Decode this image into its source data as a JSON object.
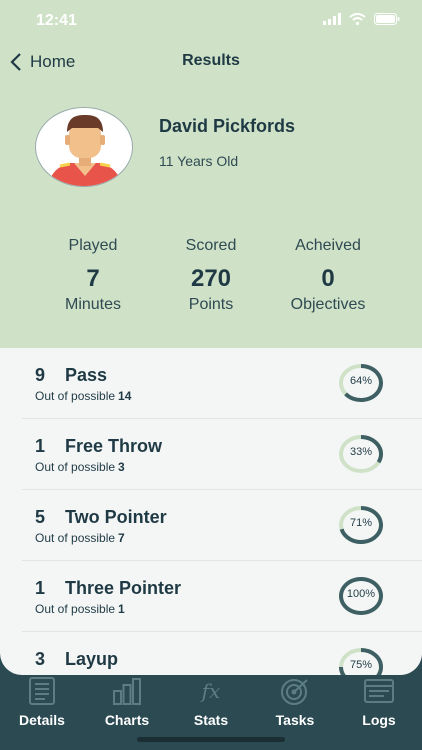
{
  "status": {
    "time": "12:41"
  },
  "nav": {
    "back_label": "Home",
    "title": "Results"
  },
  "profile": {
    "name": "David Pickfords",
    "age": "11 Years Old"
  },
  "stats": [
    {
      "label": "Played",
      "value": "7",
      "unit": "Minutes"
    },
    {
      "label": "Scored",
      "value": "270",
      "unit": "Points"
    },
    {
      "label": "Acheived",
      "value": "0",
      "unit": "Objectives"
    }
  ],
  "results": [
    {
      "count": "9",
      "name": "Pass",
      "possible_label": "Out of possible",
      "total": "14",
      "percent_label": "64%",
      "percent": 64
    },
    {
      "count": "1",
      "name": "Free Throw",
      "possible_label": "Out of possible",
      "total": "3",
      "percent_label": "33%",
      "percent": 33
    },
    {
      "count": "5",
      "name": "Two Pointer",
      "possible_label": "Out of possible",
      "total": "7",
      "percent_label": "71%",
      "percent": 71
    },
    {
      "count": "1",
      "name": "Three Pointer",
      "possible_label": "Out of possible",
      "total": "1",
      "percent_label": "100%",
      "percent": 100
    },
    {
      "count": "3",
      "name": "Layup",
      "possible_label": "",
      "total": "",
      "percent_label": "75%",
      "percent": 75
    }
  ],
  "tabs": [
    {
      "label": "Details",
      "icon": "details-icon"
    },
    {
      "label": "Charts",
      "icon": "charts-icon"
    },
    {
      "label": "Stats",
      "icon": "fx-icon"
    },
    {
      "label": "Tasks",
      "icon": "target-icon"
    },
    {
      "label": "Logs",
      "icon": "logs-icon"
    }
  ],
  "colors": {
    "header_bg": "#cfe2c8",
    "ring_track": "#cfe2c8",
    "ring_fill": "#3e5f63",
    "tabbar_bg": "#2b4a52"
  }
}
